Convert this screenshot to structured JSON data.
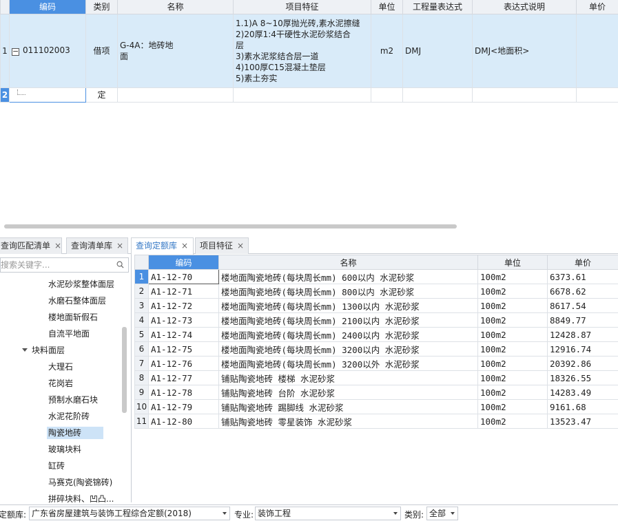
{
  "top_grid": {
    "headers": [
      "编码",
      "类别",
      "名称",
      "项目特征",
      "单位",
      "工程量表达式",
      "表达式说明",
      "单价"
    ],
    "row1": {
      "num": "1",
      "code": "011102003",
      "category": "借项",
      "name_line1": "G-4A：地砖地",
      "name_line2": "面",
      "features": [
        "1.1)A 8~10厚抛光砖,素水泥擦缝",
        "2)20厚1:4干硬性水泥砂浆结合",
        "层",
        "3)素水泥浆结合层一道",
        "4)100厚C15混凝土垫层",
        "5)素土夯实"
      ],
      "unit": "m2",
      "expression": "DMJ",
      "expression_desc": "DMJ<地面积>"
    },
    "row2": {
      "num": "2",
      "category": "定"
    }
  },
  "tabs": [
    {
      "label": "查询匹配清单",
      "close": "×"
    },
    {
      "label": "查询清单库",
      "close": "×"
    },
    {
      "label": "查询定额库",
      "close": "×"
    },
    {
      "label": "项目特征",
      "close": "×"
    }
  ],
  "left_panel": {
    "search_placeholder": "搜索关键字...",
    "tree": [
      {
        "label": "水泥砂浆整体面层",
        "level": 2
      },
      {
        "label": "水磨石整体面层",
        "level": 2
      },
      {
        "label": "楼地面斩假石",
        "level": 2
      },
      {
        "label": "自流平地面",
        "level": 2
      },
      {
        "label": "块料面层",
        "level": 1
      },
      {
        "label": "大理石",
        "level": 2
      },
      {
        "label": "花岗岩",
        "level": 2
      },
      {
        "label": "预制水磨石块",
        "level": 2
      },
      {
        "label": "水泥花阶砖",
        "level": 2
      },
      {
        "label": "陶瓷地砖",
        "level": 2,
        "selected": true
      },
      {
        "label": "玻璃块料",
        "level": 2
      },
      {
        "label": "缸砖",
        "level": 2
      },
      {
        "label": "马赛克(陶瓷锦砖)",
        "level": 2
      },
      {
        "label": "拼碎块料、凹凸...",
        "level": 2
      }
    ]
  },
  "bottom_grid": {
    "headers": [
      "编码",
      "名称",
      "单位",
      "单价"
    ],
    "rows": [
      {
        "num": "1",
        "code": "A1-12-70",
        "name": "楼地面陶瓷地砖(每块周长mm) 600以内 水泥砂浆",
        "unit": "100m2",
        "price": "6373.61"
      },
      {
        "num": "2",
        "code": "A1-12-71",
        "name": "楼地面陶瓷地砖(每块周长mm) 800以内 水泥砂浆",
        "unit": "100m2",
        "price": "6678.62"
      },
      {
        "num": "3",
        "code": "A1-12-72",
        "name": "楼地面陶瓷地砖(每块周长mm) 1300以内 水泥砂浆",
        "unit": "100m2",
        "price": "8617.54"
      },
      {
        "num": "4",
        "code": "A1-12-73",
        "name": "楼地面陶瓷地砖(每块周长mm) 2100以内 水泥砂浆",
        "unit": "100m2",
        "price": "8849.77"
      },
      {
        "num": "5",
        "code": "A1-12-74",
        "name": "楼地面陶瓷地砖(每块周长mm) 2400以内 水泥砂浆",
        "unit": "100m2",
        "price": "12428.87"
      },
      {
        "num": "6",
        "code": "A1-12-75",
        "name": "楼地面陶瓷地砖(每块周长mm) 3200以内 水泥砂浆",
        "unit": "100m2",
        "price": "12916.74"
      },
      {
        "num": "7",
        "code": "A1-12-76",
        "name": "楼地面陶瓷地砖(每块周长mm) 3200以外 水泥砂浆",
        "unit": "100m2",
        "price": "20392.86"
      },
      {
        "num": "8",
        "code": "A1-12-77",
        "name": "铺贴陶瓷地砖 楼梯 水泥砂浆",
        "unit": "100m2",
        "price": "18326.55"
      },
      {
        "num": "9",
        "code": "A1-12-78",
        "name": "铺贴陶瓷地砖 台阶 水泥砂浆",
        "unit": "100m2",
        "price": "14283.49"
      },
      {
        "num": "10",
        "code": "A1-12-79",
        "name": "铺贴陶瓷地砖 踢脚线 水泥砂浆",
        "unit": "100m2",
        "price": "9161.68"
      },
      {
        "num": "11",
        "code": "A1-12-80",
        "name": "铺贴陶瓷地砖 零星装饰 水泥砂浆",
        "unit": "100m2",
        "price": "13523.47"
      }
    ]
  },
  "status_bar": {
    "quota_label": "定额库:",
    "quota_value": "广东省房屋建筑与装饰工程综合定额(2018)",
    "major_label": "专业:",
    "major_value": "装饰工程",
    "type_label": "类别:",
    "type_value": "全部"
  }
}
